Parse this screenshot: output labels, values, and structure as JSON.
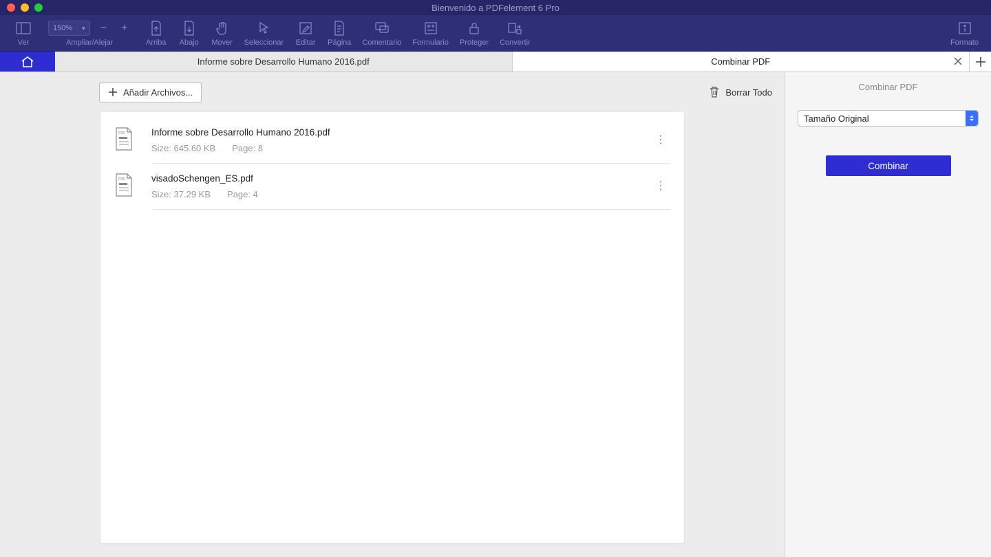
{
  "window": {
    "title": "Bienvenido a PDFelement 6 Pro"
  },
  "toolbar": {
    "zoom_value": "150%",
    "items": {
      "ver": "Ver",
      "zoom": "Ampliar/Alejar",
      "arriba": "Arriba",
      "abajo": "Abajo",
      "mover": "Mover",
      "seleccionar": "Seleccionar",
      "editar": "Editar",
      "pagina": "Página",
      "comentario": "Comentario",
      "formulario": "Formulario",
      "proteger": "Proteger",
      "convertir": "Convertir",
      "formato": "Formato"
    }
  },
  "tabs": {
    "document": "Informe sobre Desarrollo Humano 2016.pdf",
    "combine": "Combinar PDF"
  },
  "actions": {
    "add_files": "Añadir Archivos...",
    "delete_all": "Borrar Todo"
  },
  "files": [
    {
      "name": "Informe sobre Desarrollo Humano 2016.pdf",
      "size": "Size: 645.60 KB",
      "pages": "Page: 8"
    },
    {
      "name": "visadoSchengen_ES.pdf",
      "size": "Size: 37.29 KB",
      "pages": "Page: 4"
    }
  ],
  "sidebar": {
    "title": "Combinar PDF",
    "size_option": "Tamaño Original",
    "combine_button": "Combinar"
  }
}
